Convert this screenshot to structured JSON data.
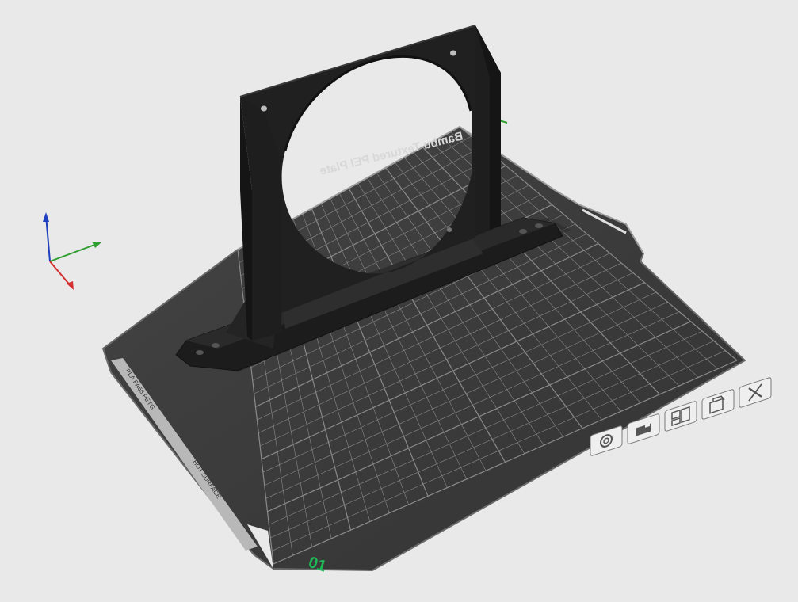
{
  "viewport": {
    "background_color": "#e9e9e9",
    "plate_color": "#3c3c3c",
    "grid_color": "#8a8a8a",
    "model_color": "#1f1f1f"
  },
  "plate": {
    "label": "Bambu Textured PEI Plate",
    "number": "01",
    "number_color": "#1db954",
    "side_labels": [
      "PLA PA66 PETG",
      "HOT SURFACE"
    ]
  },
  "axes": {
    "x_color": "#d32f2f",
    "y_color": "#2e9e2e",
    "z_color": "#1f3fbf"
  },
  "plate_toolbar": {
    "buttons": [
      {
        "icon": "plate-settings-icon",
        "tooltip": ""
      },
      {
        "icon": "lock-plate-icon",
        "tooltip": ""
      },
      {
        "icon": "arrange-icon",
        "tooltip": ""
      },
      {
        "icon": "auto-orient-icon",
        "tooltip": ""
      },
      {
        "icon": "close-icon",
        "tooltip": ""
      }
    ]
  }
}
